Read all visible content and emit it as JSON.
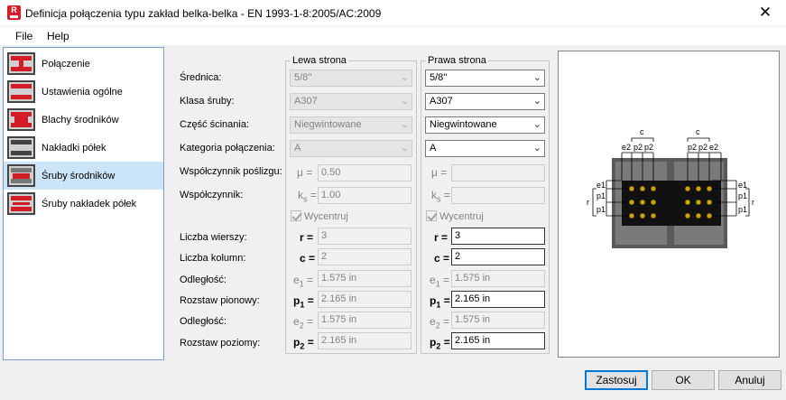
{
  "window": {
    "title": "Definicja połączenia typu zakład belka-belka - EN 1993-1-8:2005/AC:2009",
    "app_icon_letter": "R"
  },
  "menu": {
    "file": "File",
    "help": "Help"
  },
  "sidebar": {
    "items": [
      {
        "label": "Połączenie",
        "icon": "connection-icon"
      },
      {
        "label": "Ustawienia ogólne",
        "icon": "general-settings-icon"
      },
      {
        "label": "Blachy środników",
        "icon": "web-plates-icon"
      },
      {
        "label": "Nakładki półek",
        "icon": "flange-plates-icon"
      },
      {
        "label": "Śruby środników",
        "icon": "web-bolts-icon",
        "selected": true
      },
      {
        "label": "Śruby nakładek półek",
        "icon": "flange-bolts-icon"
      }
    ]
  },
  "groups": {
    "left": "Lewa strona",
    "right": "Prawa strona"
  },
  "labels": {
    "diameter": "Średnica:",
    "bolt_class": "Klasa śruby:",
    "shear_part": "Część ścinania:",
    "category": "Kategoria połączenia:",
    "friction": "Współczynnik poślizgu:",
    "coefficient": "Współczynnik:",
    "rows": "Liczba wierszy:",
    "columns": "Liczba kolumn:",
    "distance1": "Odległość:",
    "vertical_spacing": "Rozstaw pionowy:",
    "distance2": "Odległość:",
    "horizontal_spacing": "Rozstaw poziomy:"
  },
  "symbols": {
    "mu": "μ =",
    "k": "k",
    "k_sub": "s",
    "k_eq": " =",
    "r": "r =",
    "c": "c =",
    "e": "e",
    "p": "p",
    "sub1": "1",
    "sub2": "2",
    "eq": " ="
  },
  "left": {
    "diameter": "5/8''",
    "bolt_class": "A307",
    "shear_part": "Niegwintowane",
    "category": "A",
    "friction": "0.50",
    "coefficient": "1.00",
    "center": "Wycentruj",
    "rows": "3",
    "columns": "2",
    "e1": "1.575 in",
    "p1": "2.165 in",
    "e2": "1.575 in",
    "p2": "2.165 in"
  },
  "right": {
    "diameter": "5/8''",
    "bolt_class": "A307",
    "shear_part": "Niegwintowane",
    "category": "A",
    "friction": "",
    "coefficient": "",
    "center": "Wycentruj",
    "rows": "3",
    "columns": "2",
    "e1": "1.575 in",
    "p1": "2.165 in",
    "e2": "1.575 in",
    "p2": "2.165 in"
  },
  "diagram": {
    "c": "c",
    "e2": "e2",
    "p2": "p2",
    "e1": "e1",
    "p1": "p1",
    "r": "r"
  },
  "buttons": {
    "apply": "Zastosuj",
    "ok": "OK",
    "cancel": "Anuluj"
  },
  "colors": {
    "accent": "#0078d7",
    "brand_red": "#d21c26",
    "bolt": "#c8a200"
  }
}
